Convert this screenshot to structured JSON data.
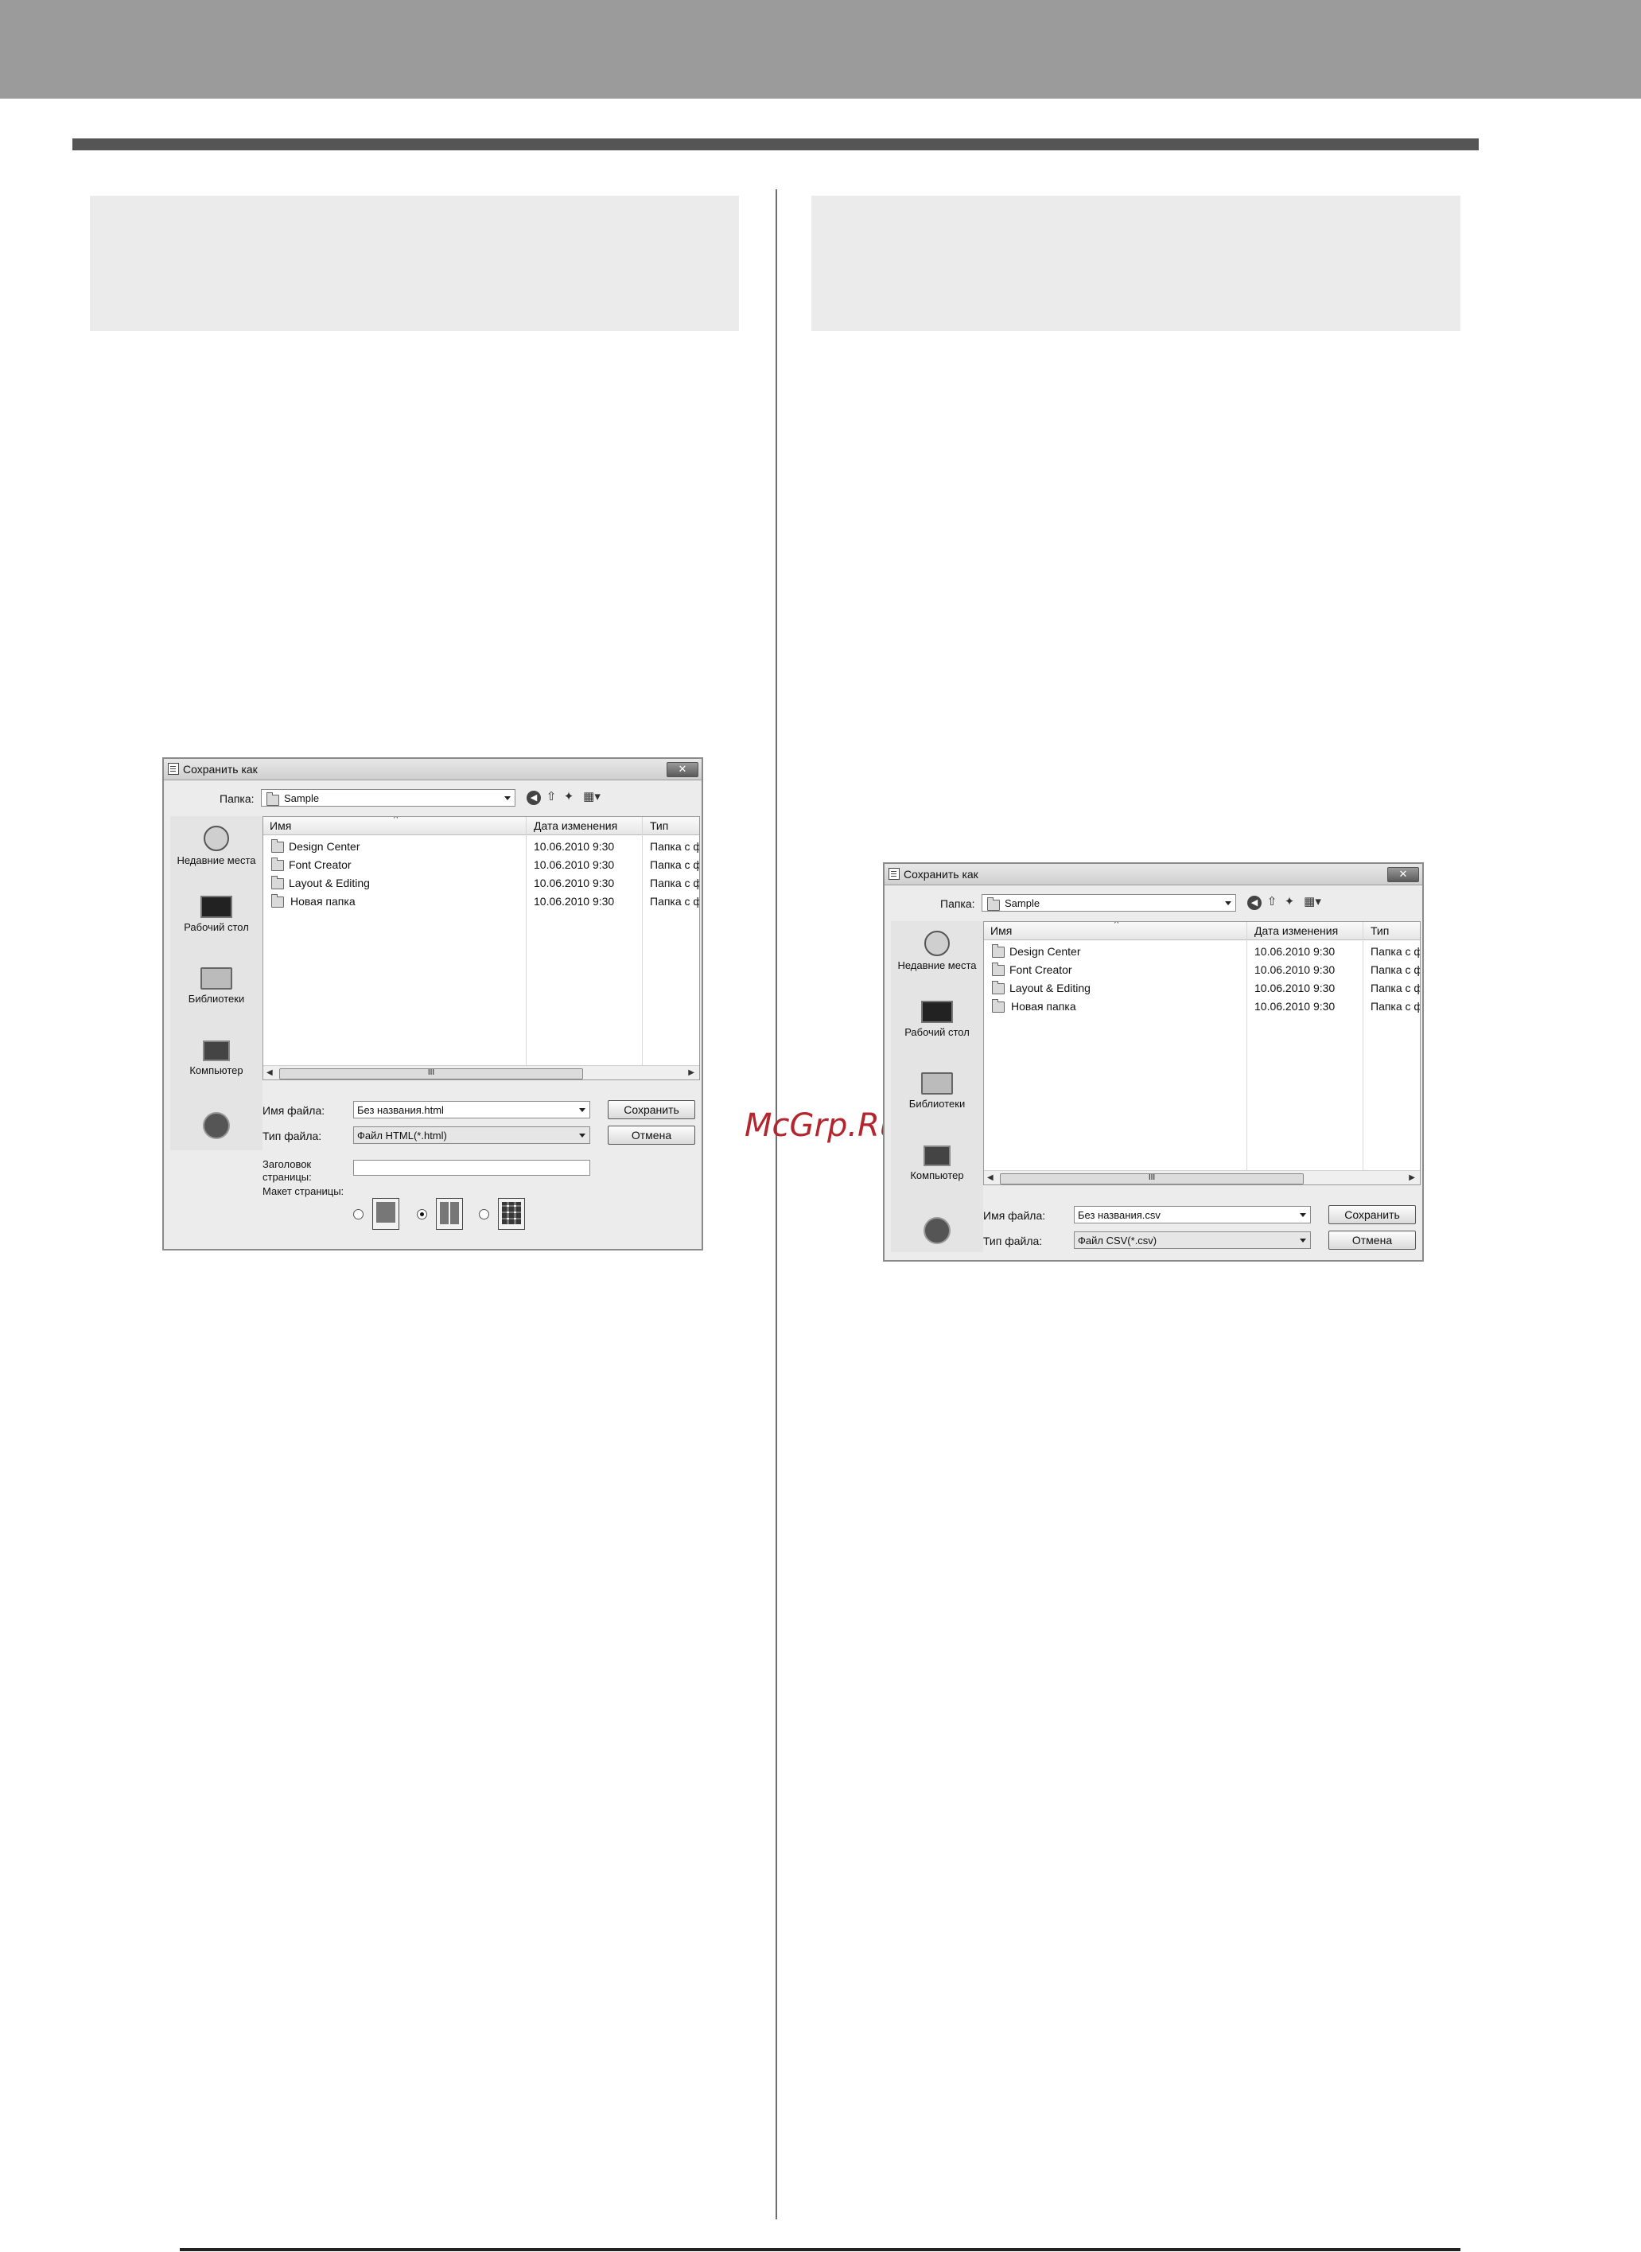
{
  "watermark": "McGrp.Ru",
  "dialogs": {
    "html": {
      "title": "Сохранить как",
      "close_glyph": "✕",
      "folder_label": "Папка:",
      "folder_value": "Sample",
      "columns": {
        "name": "Имя",
        "date": "Дата изменения",
        "type": "Тип"
      },
      "files": [
        {
          "name": "Design Center",
          "date": "10.06.2010 9:30",
          "type": "Папка с ф"
        },
        {
          "name": "Font Creator",
          "date": "10.06.2010 9:30",
          "type": "Папка с ф"
        },
        {
          "name": "Layout & Editing",
          "date": "10.06.2010 9:30",
          "type": "Папка с ф"
        },
        {
          "name": "Новая папка",
          "date": "10.06.2010 9:30",
          "type": "Папка с ф"
        }
      ],
      "places": {
        "recent": "Недавние места",
        "desktop": "Рабочий стол",
        "libraries": "Библиотеки",
        "computer": "Компьютер"
      },
      "scroll_thumb": "III",
      "filename_label": "Имя файла:",
      "filename_value": "Без названия.html",
      "filetype_label": "Тип файла:",
      "filetype_value": "Файл HTML(*.html)",
      "save_label": "Сохранить",
      "cancel_label": "Отмена",
      "page_title_label_1": "Заголовок",
      "page_title_label_2": "страницы:",
      "page_layout_label": "Макет страницы:",
      "layout_selected_index": 1
    },
    "csv": {
      "title": "Сохранить как",
      "close_glyph": "✕",
      "folder_label": "Папка:",
      "folder_value": "Sample",
      "columns": {
        "name": "Имя",
        "date": "Дата изменения",
        "type": "Тип"
      },
      "files": [
        {
          "name": "Design Center",
          "date": "10.06.2010 9:30",
          "type": "Папка с ф"
        },
        {
          "name": "Font Creator",
          "date": "10.06.2010 9:30",
          "type": "Папка с ф"
        },
        {
          "name": "Layout & Editing",
          "date": "10.06.2010 9:30",
          "type": "Папка с ф"
        },
        {
          "name": "Новая папка",
          "date": "10.06.2010 9:30",
          "type": "Папка с ф"
        }
      ],
      "places": {
        "recent": "Недавние места",
        "desktop": "Рабочий стол",
        "libraries": "Библиотеки",
        "computer": "Компьютер"
      },
      "scroll_thumb": "III",
      "filename_label": "Имя файла:",
      "filename_value": "Без названия.csv",
      "filetype_label": "Тип файла:",
      "filetype_value": "Файл CSV(*.csv)",
      "save_label": "Сохранить",
      "cancel_label": "Отмена"
    }
  }
}
